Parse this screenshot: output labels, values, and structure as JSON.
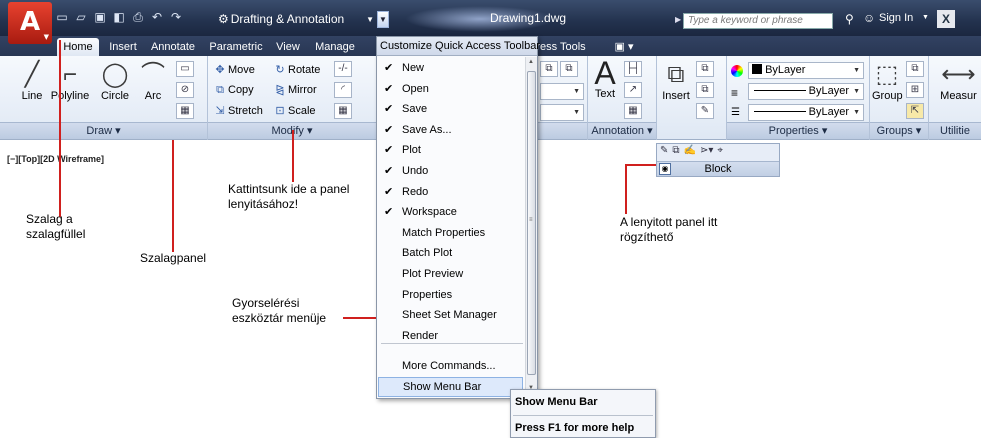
{
  "titlebar": {
    "workspace": "Drafting & Annotation",
    "document_title": "Drawing1.dwg",
    "search_placeholder": "Type a keyword or phrase",
    "sign_in": "Sign In"
  },
  "tabs": [
    "Home",
    "Insert",
    "Annotate",
    "Parametric",
    "View",
    "Manage",
    "ress Tools"
  ],
  "ribbon": {
    "draw": {
      "title": "Draw",
      "tools": [
        "Line",
        "Polyline",
        "Circle",
        "Arc"
      ]
    },
    "modify": {
      "title": "Modify",
      "tools": [
        "Move",
        "Rotate",
        "Copy",
        "Mirror",
        "Stretch",
        "Scale"
      ]
    },
    "annotation": {
      "title": "Annotation",
      "text_label": "Text"
    },
    "block": {
      "insert_label": "Insert"
    },
    "properties": {
      "title": "Properties",
      "color": "ByLayer",
      "linetype": "ByLayer",
      "lineweight": "ByLayer"
    },
    "groups": {
      "title": "Groups",
      "group_label": "Group"
    },
    "utilities": {
      "title": "Utilitie",
      "measure_label": "Measur"
    }
  },
  "viewport_label": "[−][Top][2D Wireframe]",
  "floating_panel": {
    "title": "Block"
  },
  "qat_menu": {
    "title": "Customize Quick Access Toolbar",
    "items": [
      {
        "label": "New",
        "checked": true
      },
      {
        "label": "Open",
        "checked": true
      },
      {
        "label": "Save",
        "checked": true
      },
      {
        "label": "Save As...",
        "checked": true
      },
      {
        "label": "Plot",
        "checked": true
      },
      {
        "label": "Undo",
        "checked": true
      },
      {
        "label": "Redo",
        "checked": true
      },
      {
        "label": "Workspace",
        "checked": true
      },
      {
        "label": "Match Properties",
        "checked": false
      },
      {
        "label": "Batch Plot",
        "checked": false
      },
      {
        "label": "Plot Preview",
        "checked": false
      },
      {
        "label": "Properties",
        "checked": false
      },
      {
        "label": "Sheet Set Manager",
        "checked": false
      },
      {
        "label": "Render",
        "checked": false
      },
      {
        "label": "More Commands...",
        "checked": false
      },
      {
        "label": "Show Menu Bar",
        "checked": false
      }
    ]
  },
  "tooltip": {
    "title": "Show Menu Bar",
    "help": "Press F1 for more help"
  },
  "annotations": {
    "ribbon_with_tabs": [
      "Szalag a",
      "szalagfüllel"
    ],
    "ribbon_panel": "Szalagpanel",
    "click_here": [
      "Kattintsunk ide a panel",
      "lenyitásához!"
    ],
    "qat_menu": [
      "Gyorselérési",
      "eszköztár menüje"
    ],
    "dropped_panel": [
      "A lenyitott panel itt",
      "rögzíthető"
    ]
  },
  "colors": {
    "titlebar": "#23324e",
    "ribbon": "#dfe8f4",
    "annotation_line": "#d0201e",
    "menu_highlight": "#dde9fb"
  }
}
